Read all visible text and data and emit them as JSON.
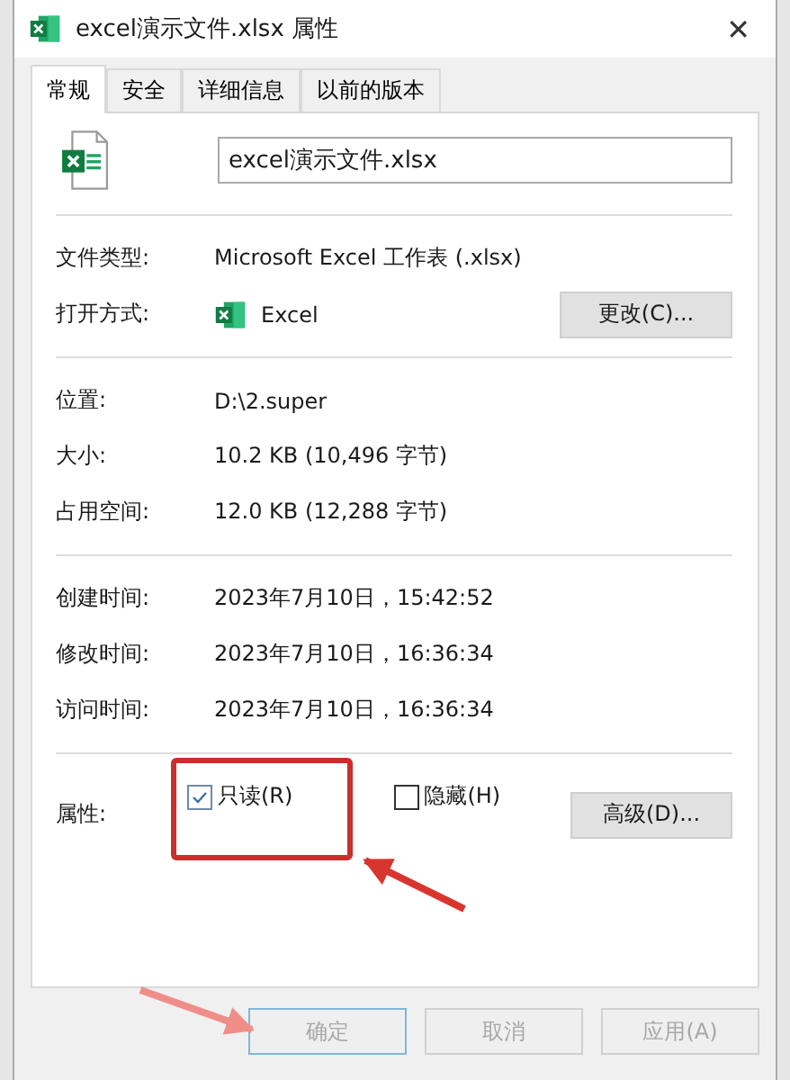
{
  "window": {
    "title": "excel演示文件.xlsx 属性",
    "close": "✕"
  },
  "tabs": [
    {
      "label": "常规",
      "selected": true
    },
    {
      "label": "安全",
      "selected": false
    },
    {
      "label": "详细信息",
      "selected": false
    },
    {
      "label": "以前的版本",
      "selected": false
    }
  ],
  "file_name": {
    "value": "excel演示文件.xlsx"
  },
  "sections": [
    {
      "rows": [
        {
          "kind": "text",
          "label": "文件类型:",
          "value": "Microsoft Excel 工作表 (.xlsx)"
        },
        {
          "kind": "app",
          "label": "打开方式:",
          "value": "Excel",
          "button": "更改(C)..."
        }
      ]
    },
    {
      "rows": [
        {
          "kind": "text",
          "label": "位置:",
          "value": "D:\\2.super"
        },
        {
          "kind": "text",
          "label": "大小:",
          "value": "10.2 KB (10,496 字节)"
        },
        {
          "kind": "text",
          "label": "占用空间:",
          "value": "12.0 KB (12,288 字节)"
        }
      ]
    },
    {
      "rows": [
        {
          "kind": "text",
          "label": "创建时间:",
          "value": "2023年7月10日，15:42:52"
        },
        {
          "kind": "text",
          "label": "修改时间:",
          "value": "2023年7月10日，16:36:34"
        },
        {
          "kind": "text",
          "label": "访问时间:",
          "value": "2023年7月10日，16:36:34"
        }
      ]
    }
  ],
  "attributes": {
    "label": "属性:",
    "items": [
      {
        "label": "只读(R)",
        "checked": true,
        "highlighted": true
      },
      {
        "label": "隐藏(H)",
        "checked": false,
        "highlighted": false
      }
    ],
    "button": "高级(D)..."
  },
  "buttons": [
    {
      "label": "确定",
      "disabled": true,
      "default": true
    },
    {
      "label": "取消",
      "disabled": true,
      "default": false
    },
    {
      "label": "应用(A)",
      "disabled": true,
      "default": false
    }
  ]
}
